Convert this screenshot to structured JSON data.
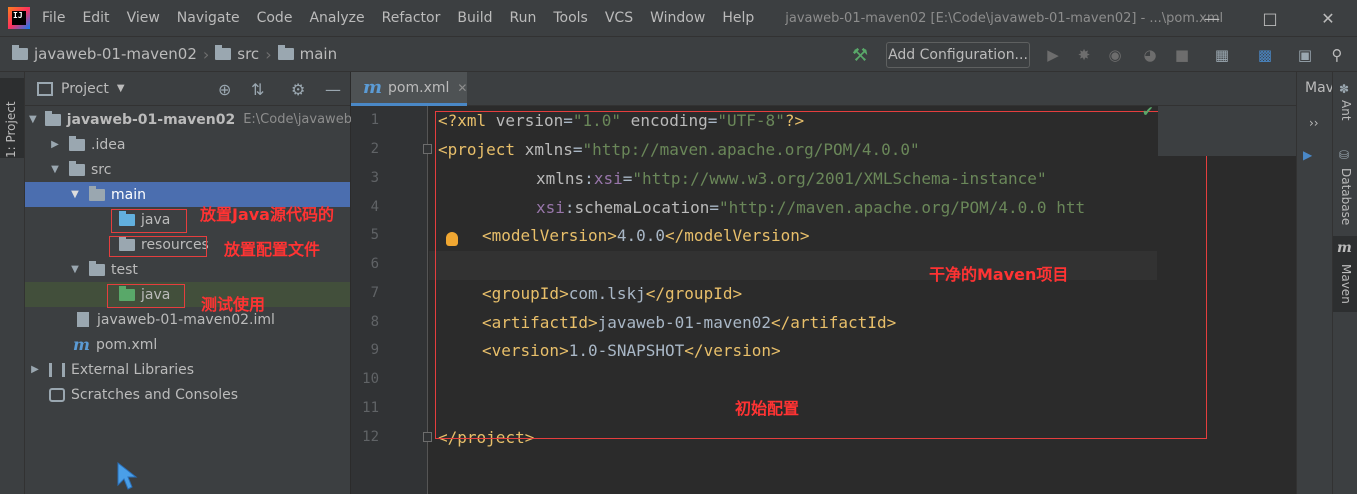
{
  "menubar": {
    "items": [
      "File",
      "Edit",
      "View",
      "Navigate",
      "Code",
      "Analyze",
      "Refactor",
      "Build",
      "Run",
      "Tools",
      "VCS",
      "Window",
      "Help"
    ],
    "title": "javaweb-01-maven02 [E:\\Code\\javaweb-01-maven02] - ...\\pom.xml",
    "logo_text": "IJ"
  },
  "navbar": {
    "crumbs": [
      "javaweb-01-maven02",
      "src",
      "main"
    ],
    "add_config_label": "Add Configuration..."
  },
  "left_strip": {
    "label": "1: Project"
  },
  "project_panel": {
    "title": "Project",
    "rows": [
      {
        "label": "javaweb-01-maven02",
        "hint": "E:\\Code\\javaweb-"
      },
      {
        "label": ".idea"
      },
      {
        "label": "src"
      },
      {
        "label": "main"
      },
      {
        "label": "java"
      },
      {
        "label": "resources"
      },
      {
        "label": "test"
      },
      {
        "label": "java"
      },
      {
        "label": "javaweb-01-maven02.iml"
      },
      {
        "label": "pom.xml"
      },
      {
        "label": "External Libraries"
      },
      {
        "label": "Scratches and Consoles"
      }
    ]
  },
  "annotations": {
    "java_source": "放置Java源代码的",
    "resources_config": "放置配置文件",
    "test_use": "测试使用",
    "clean_maven": "干净的Maven项目",
    "initial_config": "初始配置"
  },
  "editor": {
    "tab_label": "pom.xml",
    "line_numbers": [
      "1",
      "2",
      "3",
      "4",
      "5",
      "6",
      "7",
      "8",
      "9",
      "10",
      "11",
      "12"
    ],
    "code": {
      "l1": {
        "a": "<?xml ",
        "b": "version",
        "c": "=",
        "d": "\"1.0\"",
        "e": " encoding",
        "f": "=",
        "g": "\"UTF-8\"",
        "h": "?>"
      },
      "l2": {
        "a": "<project ",
        "b": "xmlns",
        "c": "=",
        "d": "\"http://maven.apache.org/POM/4.0.0\""
      },
      "l3": {
        "a": "xmlns",
        "b": ":",
        "c": "xsi",
        "d": "=",
        "e": "\"http://www.w3.org/2001/XMLSchema-instance\""
      },
      "l4": {
        "a": "xsi",
        "b": ":",
        "c": "schemaLocation",
        "d": "=",
        "e": "\"http://maven.apache.org/POM/4.0.0 htt"
      },
      "l5": {
        "a": "<modelVersion>",
        "b": "4.0.0",
        "c": "</modelVersion>"
      },
      "l7": {
        "a": "<groupId>",
        "b": "com.lskj",
        "c": "</groupId>"
      },
      "l8": {
        "a": "<artifactId>",
        "b": "javaweb-01-maven02",
        "c": "</artifactId>"
      },
      "l9": {
        "a": "<version>",
        "b": "1.0-SNAPSHOT",
        "c": "</version>"
      },
      "l12": {
        "a": "</project>"
      }
    }
  },
  "right_panel": {
    "maven_title": "Mav",
    "labels": [
      "Ant",
      "Database",
      "Maven"
    ]
  },
  "icons": {
    "hammer": "hammer-icon",
    "run": "run-icon",
    "debug": "debug-icon",
    "search": "search-icon"
  }
}
